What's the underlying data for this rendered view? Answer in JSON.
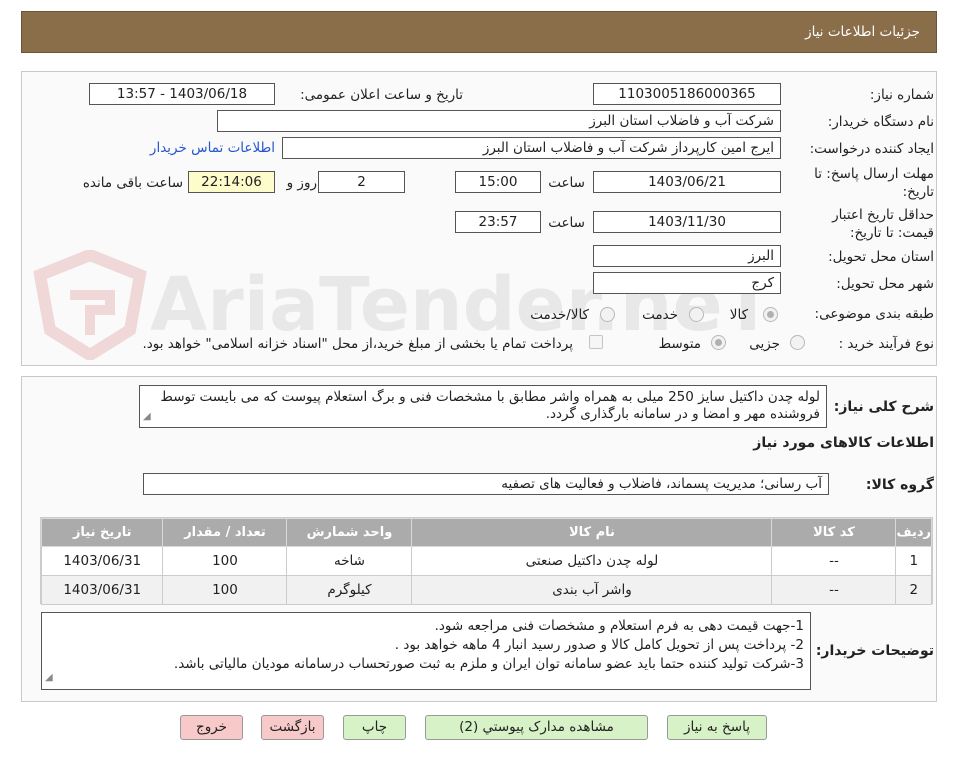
{
  "header": {
    "title": "جزئیات اطلاعات نیاز"
  },
  "watermark": "AriaTender.neT",
  "need": {
    "need_number_label": "شماره نیاز:",
    "need_number": "1103005186000365",
    "announce_label": "تاریخ و ساعت اعلان عمومی:",
    "announce_value": "1403/06/18 - 13:57",
    "buyer_org_label": "نام دستگاه خریدار:",
    "buyer_org": "شرکت آب و فاضلاب استان البرز",
    "creator_label": "ایجاد کننده درخواست:",
    "creator": "ایرج امین کارپرداز شرکت آب و فاضلاب استان البرز",
    "contact_link": "اطلاعات تماس خریدار",
    "deadline_label_1": "مهلت ارسال پاسخ: تا",
    "deadline_label_2": "تاریخ:",
    "deadline_date": "1403/06/21",
    "time_label": "ساعت",
    "deadline_time": "15:00",
    "days_value": "2",
    "days_label": "روز و",
    "remaining_time": "22:14:06",
    "remaining_label": "ساعت باقی مانده",
    "validity_label_1": "حداقل تاریخ اعتبار",
    "validity_label_2": "قیمت: تا تاریخ:",
    "validity_date": "1403/11/30",
    "validity_time": "23:57",
    "province_label": "استان محل تحویل:",
    "province": "البرز",
    "city_label": "شهر محل تحویل:",
    "city": "کرج",
    "category_label": "طبقه بندی موضوعی:",
    "category_options": [
      "کالا",
      "خدمت",
      "کالا/خدمت"
    ],
    "category_selected": "کالا",
    "process_label": "نوع فرآیند خرید :",
    "process_options": [
      "جزیی",
      "متوسط"
    ],
    "process_selected": "متوسط",
    "payment_note": "پرداخت تمام یا بخشی از مبلغ خرید،از محل \"اسناد خزانه اسلامی\" خواهد بود."
  },
  "summary": {
    "label": "شرح کلی نیاز:",
    "text": "لوله چدن داکتیل سایز 250 میلی به همراه واشر مطابق با مشخصات فنی و برگ استعلام پیوست که می بایست توسط فروشنده مهر و امضا و در سامانه بارگذاری گردد."
  },
  "goods": {
    "section_title": "اطلاعات کالاهای مورد نیاز",
    "group_label": "گروه کالا:",
    "group_value": "آب رسانی؛ مدیریت پسماند، فاضلاب و فعالیت های تصفیه",
    "columns": [
      "ردیف",
      "کد کالا",
      "نام کالا",
      "واحد شمارش",
      "تعداد / مقدار",
      "تاریخ نیاز"
    ],
    "rows": [
      [
        "1",
        "--",
        "لوله چدن داکتیل صنعتی",
        "شاخه",
        "100",
        "1403/06/31"
      ],
      [
        "2",
        "--",
        "واشر آب بندی",
        "کیلوگرم",
        "100",
        "1403/06/31"
      ]
    ]
  },
  "buyer_notes": {
    "label": "توضیحات خریدار:",
    "lines": [
      "1-جهت قیمت دهی به فرم استعلام و مشخصات فنی مراجعه شود.",
      "2- پرداخت پس از تحویل کامل کالا و صدور رسید انبار 4 ماهه خواهد بود .",
      "3-شرکت تولید کننده حتما باید عضو سامانه توان ایران و ملزم به ثبت صورتحساب درسامانه مودیان مالیاتی باشد."
    ]
  },
  "buttons": {
    "reply": "پاسخ به نیاز",
    "attachments": "مشاهده مدارک پیوستي (2)",
    "print": "چاپ",
    "back": "بازگشت",
    "exit": "خروج"
  },
  "colors": {
    "header_bg": "#8a6d49",
    "link": "#2456d1",
    "green_button": "#d8f2c8",
    "red_button": "#f7c9c9"
  }
}
